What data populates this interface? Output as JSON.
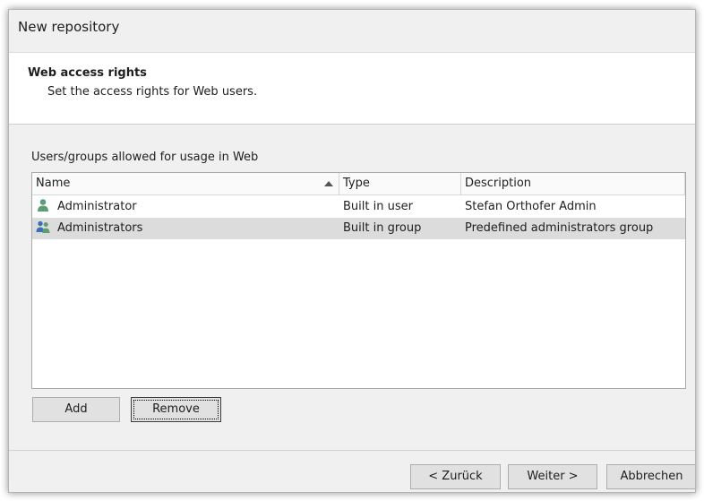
{
  "window": {
    "title": "New repository"
  },
  "header": {
    "title": "Web access rights",
    "subtitle": "Set the access rights for Web users."
  },
  "list": {
    "label": "Users/groups allowed for usage in Web",
    "columns": {
      "name": "Name",
      "type": "Type",
      "description": "Description"
    },
    "sort": {
      "column": "Name",
      "direction": "ascending"
    },
    "rows": [
      {
        "icon": "user-icon",
        "name": "Administrator",
        "type": "Built in user",
        "description": "Stefan Orthofer Admin",
        "selected": false
      },
      {
        "icon": "group-icon",
        "name": "Administrators",
        "type": "Built in group",
        "description": "Predefined administrators group",
        "selected": true
      }
    ]
  },
  "buttons": {
    "add": "Add",
    "remove": "Remove",
    "back": "< Zurück",
    "next": "Weiter >",
    "cancel": "Abbrechen"
  },
  "colors": {
    "window_bg": "#f0f0f0",
    "selected_row": "#dcdcdc",
    "user_icon": "#5a9e72",
    "group_icon": "#3d6fb5"
  }
}
